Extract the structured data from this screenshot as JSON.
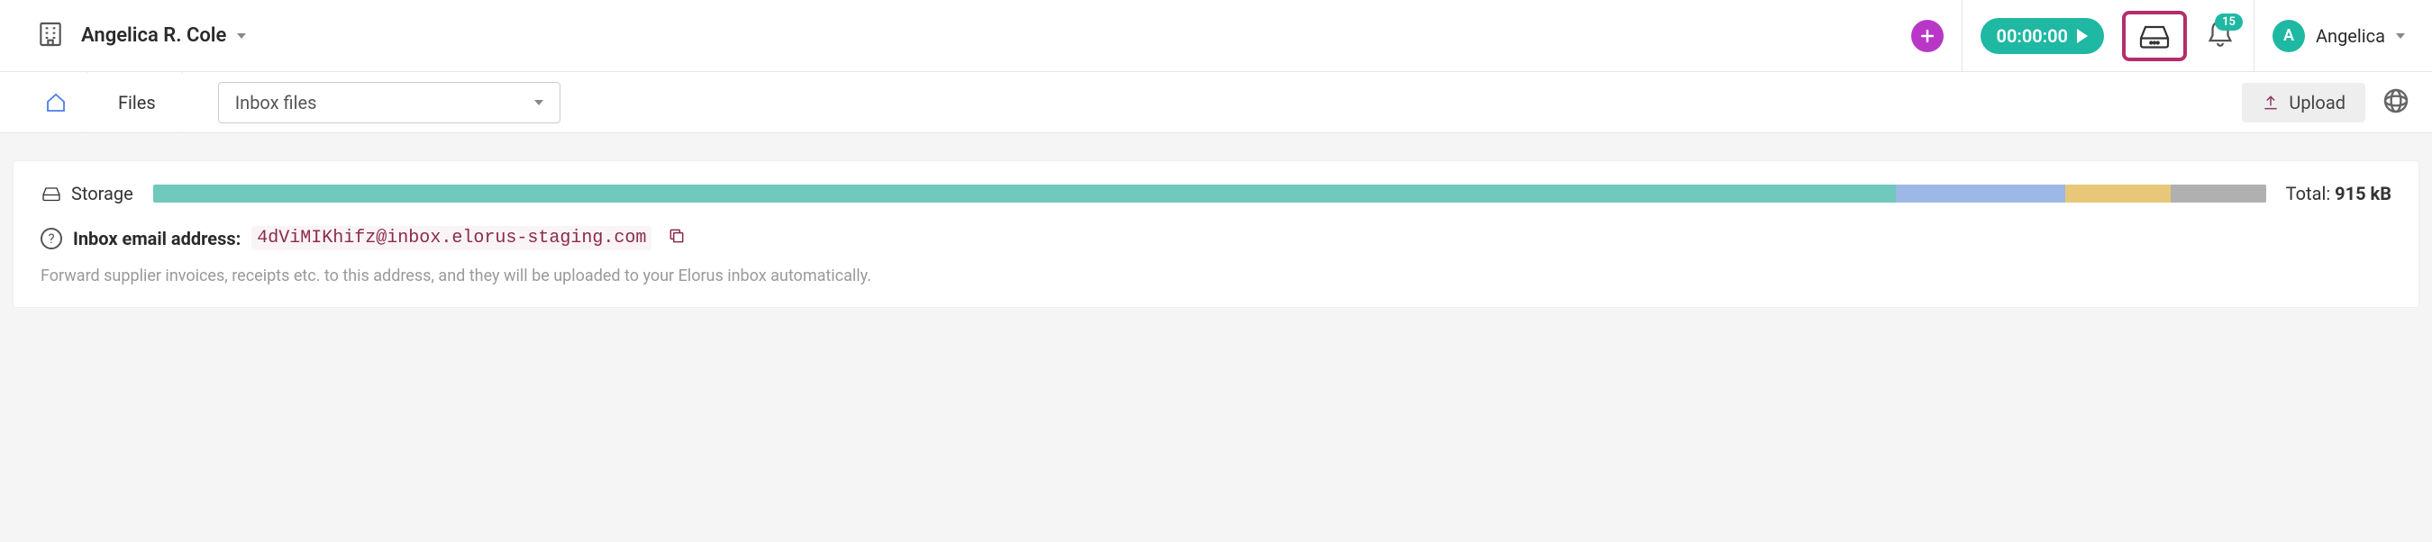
{
  "header": {
    "org_name": "Angelica R. Cole",
    "timer": "00:00:00",
    "notification_count": "15",
    "user_initial": "A",
    "user_name": "Angelica"
  },
  "breadcrumb": {
    "files_label": "Files",
    "folder_select": "Inbox files"
  },
  "actions": {
    "upload_label": "Upload"
  },
  "storage": {
    "label": "Storage",
    "total_label": "Total:",
    "total_value": "915 kB",
    "segments": [
      {
        "width_pct": 82.5,
        "color_class": "s1"
      },
      {
        "width_pct": 8,
        "color_class": "s2"
      },
      {
        "width_pct": 5,
        "color_class": "s3"
      },
      {
        "width_pct": 4.5,
        "color_class": "s4"
      }
    ]
  },
  "inbox": {
    "label": "Inbox email address:",
    "email": "4dViMIKhifz@inbox.elorus-staging.com",
    "hint": "Forward supplier invoices, receipts etc. to this address, and they will be uploaded to your Elorus inbox automatically."
  }
}
